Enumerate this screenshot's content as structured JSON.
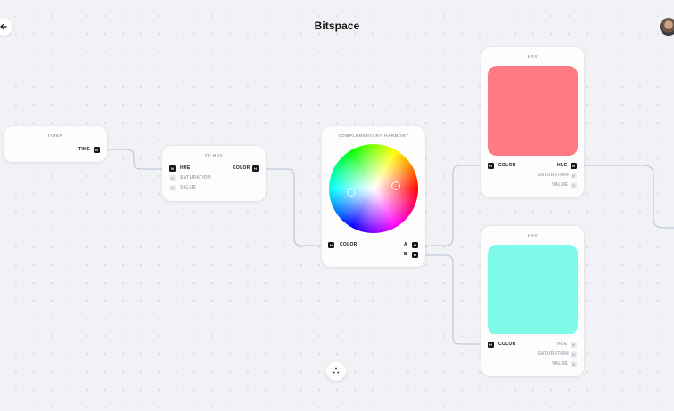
{
  "app": {
    "title": "Bitspace"
  },
  "nodes": {
    "timer": {
      "title": "TIMER",
      "outputs": [
        {
          "label": "TIME",
          "port": "N"
        }
      ]
    },
    "to_hsv": {
      "title": "TO HSV",
      "inputs": [
        {
          "label": "HUE",
          "port": "N"
        },
        {
          "label": "SATURATION",
          "port": "N"
        },
        {
          "label": "VALUE",
          "port": "N"
        }
      ],
      "outputs": [
        {
          "label": "COLOR",
          "port": "H"
        }
      ]
    },
    "harmony": {
      "title": "COMPLEMENTARY HARMONY",
      "inputs": [
        {
          "label": "COLOR",
          "port": "H"
        }
      ],
      "outputs": [
        {
          "label": "A",
          "port": "H"
        },
        {
          "label": "B",
          "port": "H"
        }
      ]
    },
    "hsv_a": {
      "title": "HSV",
      "swatch_color": "#ff7a82",
      "inputs": [
        {
          "label": "COLOR",
          "port": "H"
        }
      ],
      "outputs": [
        {
          "label": "HUE",
          "port": "N"
        },
        {
          "label": "SATURATION",
          "port": "N"
        },
        {
          "label": "VALUE",
          "port": "N"
        }
      ]
    },
    "hsv_b": {
      "title": "HSV",
      "swatch_color": "#7dfae8",
      "inputs": [
        {
          "label": "COLOR",
          "port": "H"
        }
      ],
      "outputs": [
        {
          "label": "HUE",
          "port": "N"
        },
        {
          "label": "SATURATION",
          "port": "N"
        },
        {
          "label": "VALUE",
          "port": "N"
        }
      ]
    }
  },
  "colors": {
    "background": "#f1f2f5",
    "wire": "#b9bdd6",
    "port_active": "#16161a"
  }
}
